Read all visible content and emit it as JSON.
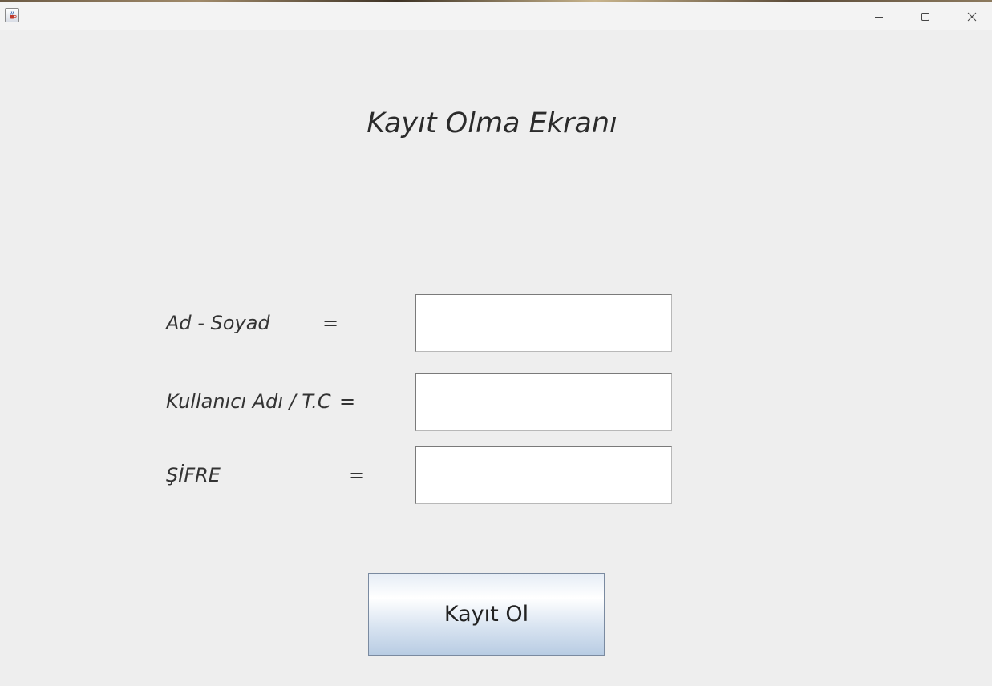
{
  "window": {
    "icon": "java-cup-icon",
    "controls": {
      "minimize": "minimize-icon",
      "maximize": "maximize-icon",
      "close": "close-icon"
    }
  },
  "form": {
    "title": "Kayıt Olma Ekranı",
    "fields": [
      {
        "label": "Ad - Soyad",
        "equals": "=",
        "value": ""
      },
      {
        "label": "Kullanıcı Adı / T.C",
        "equals": "=",
        "value": ""
      },
      {
        "label": "ŞİFRE",
        "equals": "=",
        "value": ""
      }
    ],
    "submit_label": "Kayıt Ol"
  },
  "colors": {
    "background": "#eeeeee",
    "titlebar": "#f3f3f3",
    "text": "#333333",
    "field_background": "#ffffff",
    "button_gradient_top": "#ffffff",
    "button_gradient_bottom": "#b8cce3"
  }
}
